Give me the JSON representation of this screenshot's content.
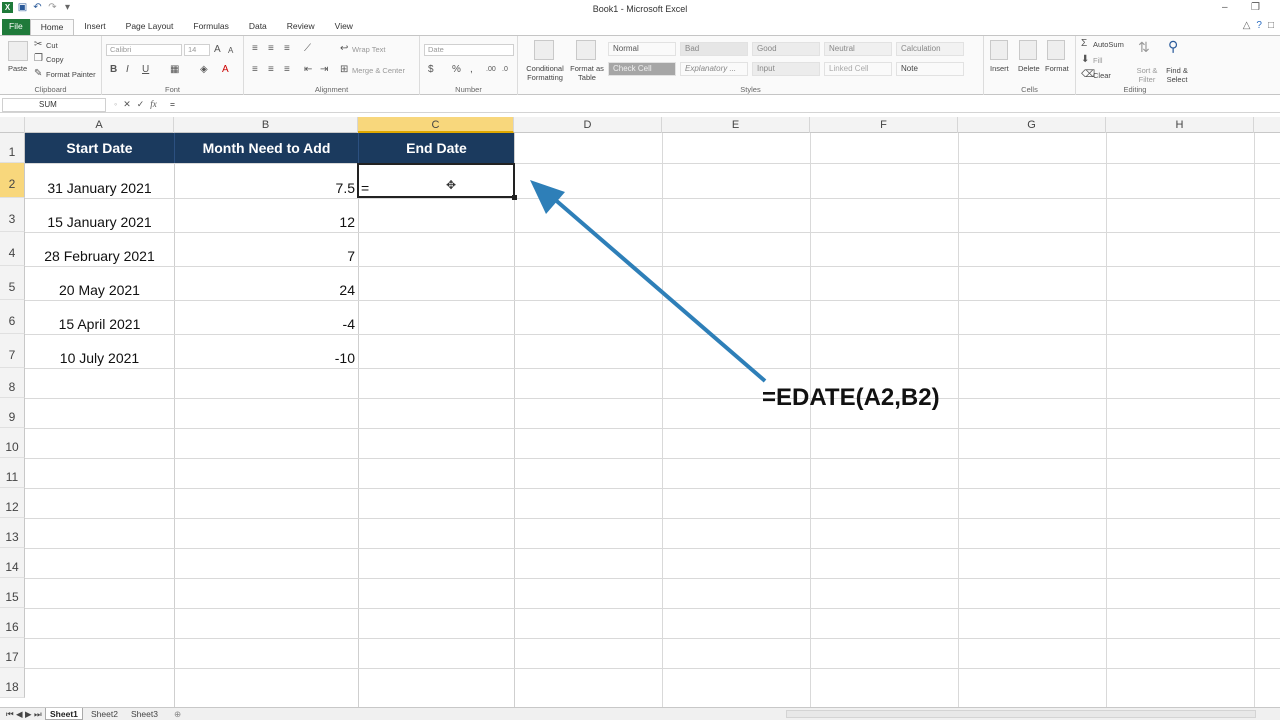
{
  "window": {
    "title": "Book1 - Microsoft Excel"
  },
  "tabs": [
    "File",
    "Home",
    "Insert",
    "Page Layout",
    "Formulas",
    "Data",
    "Review",
    "View"
  ],
  "ribbon": {
    "clipboard": {
      "paste": "Paste",
      "cut": "Cut",
      "copy": "Copy",
      "format_painter": "Format Painter",
      "label": "Clipboard"
    },
    "font": {
      "name": "Calibri",
      "size": "14",
      "label": "Font"
    },
    "alignment": {
      "wrap": "Wrap Text",
      "merge": "Merge & Center",
      "label": "Alignment"
    },
    "number": {
      "format": "Date",
      "label": "Number"
    },
    "styles": {
      "cond_fmt": "Conditional Formatting",
      "fmt_table": "Format as Table",
      "row1": [
        "Normal",
        "Bad",
        "Good",
        "Neutral",
        "Calculation"
      ],
      "row2": [
        "Check Cell",
        "Explanatory ...",
        "Input",
        "Linked Cell",
        "Note"
      ],
      "label": "Styles"
    },
    "cells": {
      "insert": "Insert",
      "delete": "Delete",
      "format": "Format",
      "label": "Cells"
    },
    "editing": {
      "autosum": "AutoSum",
      "fill": "Fill",
      "clear": "Clear",
      "sort": "Sort & Filter",
      "find": "Find & Select",
      "label": "Editing"
    }
  },
  "formula_bar": {
    "name_box": "SUM",
    "fx": "fx",
    "formula": "="
  },
  "columns": [
    "A",
    "B",
    "C",
    "D",
    "E",
    "F",
    "G",
    "H"
  ],
  "rows": [
    "1",
    "2",
    "3",
    "4",
    "5",
    "6",
    "7",
    "8",
    "9",
    "10",
    "11",
    "12",
    "13",
    "14",
    "15",
    "16",
    "17",
    "18"
  ],
  "table": {
    "headers": [
      "Start Date",
      "Month Need to Add",
      "End Date"
    ],
    "rows": [
      [
        "31 January 2021",
        "7.5",
        "="
      ],
      [
        "15 January 2021",
        "12",
        ""
      ],
      [
        "28 February 2021",
        "7",
        ""
      ],
      [
        "20 May 2021",
        "24",
        ""
      ],
      [
        "15 April 2021",
        "-4",
        ""
      ],
      [
        "10 July 2021",
        "-10",
        ""
      ]
    ]
  },
  "annotation": "=EDATE(A2,B2)",
  "sheets": [
    "Sheet1",
    "Sheet2",
    "Sheet3"
  ],
  "colors": {
    "header_bg": "#1b3a5e",
    "arrow": "#2e7fb8",
    "selection": "#f8d77c",
    "file_tab": "#1f7a3a"
  }
}
